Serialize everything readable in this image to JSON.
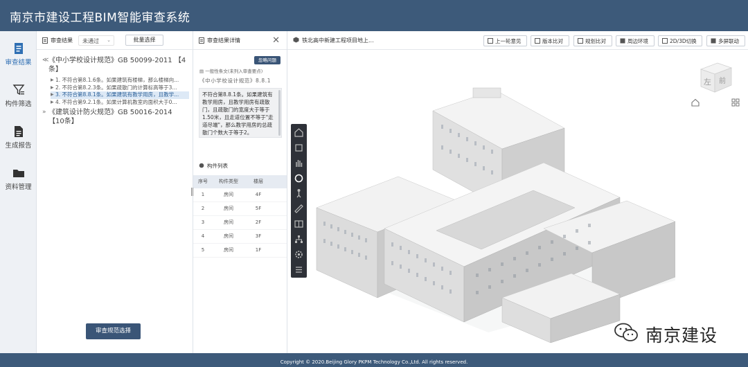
{
  "app": {
    "title": "南京市建设工程BIM智能审查系统"
  },
  "nav": {
    "items": [
      {
        "label": "审查结果",
        "icon": "document-list-icon"
      },
      {
        "label": "构件筛选",
        "icon": "filter-icon"
      },
      {
        "label": "生成报告",
        "icon": "report-icon"
      },
      {
        "label": "资料管理",
        "icon": "folder-icon"
      }
    ]
  },
  "results": {
    "header_label": "审查结果",
    "filter_value": "未通过",
    "batch_button": "批量选择",
    "groups": [
      {
        "title": "《中小学校设计规范》GB 50099-2011 【4条】",
        "items": [
          "1. 不符合第8.1.6条。如果建筑有楼梯，那么楼梯向...",
          "2. 不符合第8.2.3条。如果疏散门的计算标高等于3...",
          "3. 不符合第8.8.1条。如果建筑有教学用房，且教学...",
          "4. 不符合第9.2.1条。如果计算机教室的面积大于0..."
        ]
      },
      {
        "title": "《建筑设计防火规范》GB 50016-2014 【10条】",
        "items": []
      }
    ],
    "primary_button": "审查规范选择"
  },
  "detail": {
    "header_label": "审查结果详情",
    "ignore_button": "忽略问题",
    "subtitle": "一般性条文(未列入审查要点)",
    "reference": "《中小学校设计规范》8.8.1",
    "text": "不符合第8.8.1条。如果建筑有教学用房，且教学用房有疏散门，且疏散门的宽度大于等于1.50米，且走道位置不等于\"走道尽端\"，那么教学用房的总疏散门个数大于等于2。",
    "component_list_label": "构件列表",
    "table_headers": [
      "序号",
      "构件类型",
      "楼层"
    ],
    "table_rows": [
      [
        "1",
        "房间",
        "4F"
      ],
      [
        "2",
        "房间",
        "5F"
      ],
      [
        "3",
        "房间",
        "2F"
      ],
      [
        "4",
        "房间",
        "3F"
      ],
      [
        "5",
        "房间",
        "1F"
      ]
    ]
  },
  "viewer": {
    "project_title": "铁北高中新建工程项目地上...",
    "buttons": [
      "上一轮意见",
      "版本比对",
      "规划比对",
      "周边环境",
      "2D/3D切换",
      "多屏联动"
    ],
    "cube_labels": [
      "左",
      "前"
    ]
  },
  "watermark": {
    "text": "南京建设"
  },
  "footer": {
    "text": "Copyright © 2020.Beijing Glory PKPM Technology Co.,Ltd. All rights reserved."
  }
}
